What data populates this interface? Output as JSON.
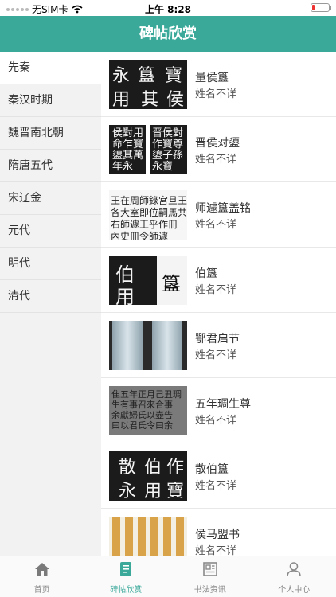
{
  "status_bar": {
    "carrier": "无SIM卡",
    "time": "上午 8:28"
  },
  "header": {
    "title": "碑帖欣赏"
  },
  "sidebar": {
    "items": [
      {
        "label": "先秦"
      },
      {
        "label": "秦汉时期"
      },
      {
        "label": "魏晋南北朝"
      },
      {
        "label": "隋唐五代"
      },
      {
        "label": "宋辽金"
      },
      {
        "label": "元代"
      },
      {
        "label": "明代"
      },
      {
        "label": "清代"
      }
    ],
    "active_index": 0
  },
  "list": {
    "items": [
      {
        "title": "量侯簋",
        "author": "姓名不详",
        "image": "rubbing-dark"
      },
      {
        "title": "晋侯对盨",
        "author": "姓名不详",
        "image": "rubbing-dark"
      },
      {
        "title": "师遽簋盖铭",
        "author": "姓名不详",
        "image": "inscription-paper"
      },
      {
        "title": "伯簋",
        "author": "姓名不详",
        "image": "rubbing-dark"
      },
      {
        "title": "鄂君启节",
        "author": "姓名不详",
        "image": "bronze-tally"
      },
      {
        "title": "五年琱生尊",
        "author": "姓名不详",
        "image": "rubbing-gray"
      },
      {
        "title": "散伯簋",
        "author": "姓名不详",
        "image": "rubbing-dark"
      },
      {
        "title": "侯马盟书",
        "author": "姓名不详",
        "image": "bamboo-slips"
      }
    ]
  },
  "tabbar": {
    "tabs": [
      {
        "label": "首页",
        "icon": "home-icon"
      },
      {
        "label": "碑帖欣赏",
        "icon": "document-icon"
      },
      {
        "label": "书法资讯",
        "icon": "news-icon"
      },
      {
        "label": "个人中心",
        "icon": "person-icon"
      }
    ],
    "active_index": 1
  },
  "colors": {
    "accent": "#3aa99a",
    "sidebar_bg": "#f2f2f2",
    "battery": "#e33333"
  }
}
